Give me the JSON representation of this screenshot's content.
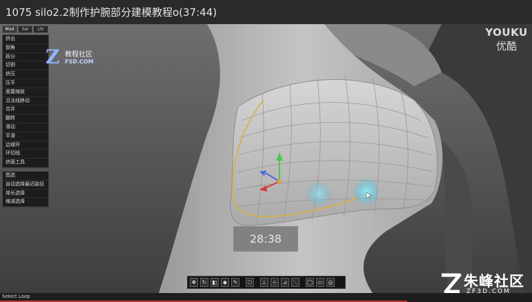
{
  "window": {
    "title": "1075 silo2.2制作护腕部分建模教程o(37:44)"
  },
  "panel": {
    "tabs": [
      "Mod",
      "Sel",
      "UV"
    ],
    "group1": [
      "挤出",
      "倒角",
      "拆分",
      "切割",
      "挤压",
      "压平",
      "面置缩放",
      "沿法线移动",
      "合并",
      "翻转",
      "滑动",
      "平滑",
      "边缘环",
      "环切线",
      "挤面工具"
    ],
    "group2": [
      "图选",
      "自动选择最近路径",
      "增长选择",
      "缩减选择"
    ]
  },
  "logo_left": {
    "glyph": "Z",
    "line1": "教程社区",
    "line2": "FSD.COM"
  },
  "video": {
    "time_overlay": "28:38"
  },
  "youku": {
    "latin": "YOUKU",
    "chinese": "优酷"
  },
  "toolbar": {
    "buttons": [
      "move-tool-icon",
      "rotate-tool-icon",
      "scale-tool-icon",
      "select-tool-icon",
      "brush-tool-icon",
      "object-mode-icon",
      "vertex-mode-icon",
      "edge-mode-icon",
      "face-mode-icon",
      "view-a-icon",
      "view-b-icon",
      "view-c-icon"
    ]
  },
  "status": {
    "text": "Select Loop"
  },
  "watermark": {
    "glyph": "Z",
    "text": "朱峰社区",
    "domain": "ZF3D.COM"
  },
  "colors": {
    "accent_red": "#c63a2e",
    "selection_loop": "#d8b040",
    "highlight_cyan": "#6fdcf0"
  }
}
